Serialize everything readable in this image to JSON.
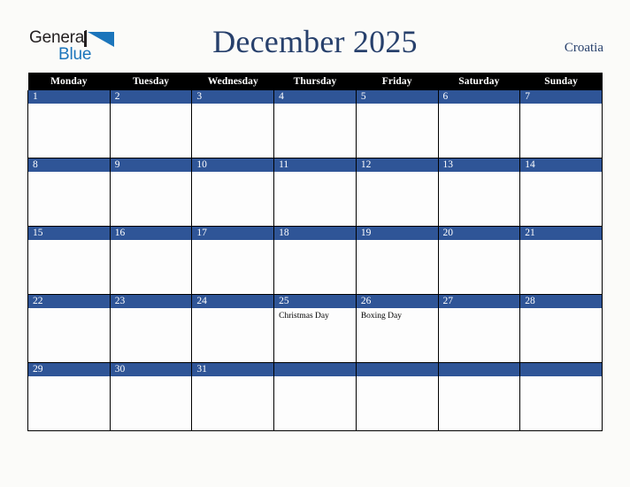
{
  "brand": {
    "word_one": "General",
    "word_two": "Blue",
    "triangle_icon": "triangle-icon",
    "accent_color": "#1b75bb"
  },
  "header": {
    "title": "December 2025",
    "country": "Croatia",
    "title_color": "#27406c"
  },
  "calendar": {
    "weekday_headers": [
      "Monday",
      "Tuesday",
      "Wednesday",
      "Thursday",
      "Friday",
      "Saturday",
      "Sunday"
    ],
    "day_bar_color": "#2f5597",
    "header_bar_color": "#000000",
    "weeks": [
      [
        {
          "day": "1",
          "events": []
        },
        {
          "day": "2",
          "events": []
        },
        {
          "day": "3",
          "events": []
        },
        {
          "day": "4",
          "events": []
        },
        {
          "day": "5",
          "events": []
        },
        {
          "day": "6",
          "events": []
        },
        {
          "day": "7",
          "events": []
        }
      ],
      [
        {
          "day": "8",
          "events": []
        },
        {
          "day": "9",
          "events": []
        },
        {
          "day": "10",
          "events": []
        },
        {
          "day": "11",
          "events": []
        },
        {
          "day": "12",
          "events": []
        },
        {
          "day": "13",
          "events": []
        },
        {
          "day": "14",
          "events": []
        }
      ],
      [
        {
          "day": "15",
          "events": []
        },
        {
          "day": "16",
          "events": []
        },
        {
          "day": "17",
          "events": []
        },
        {
          "day": "18",
          "events": []
        },
        {
          "day": "19",
          "events": []
        },
        {
          "day": "20",
          "events": []
        },
        {
          "day": "21",
          "events": []
        }
      ],
      [
        {
          "day": "22",
          "events": []
        },
        {
          "day": "23",
          "events": []
        },
        {
          "day": "24",
          "events": []
        },
        {
          "day": "25",
          "events": [
            "Christmas Day"
          ]
        },
        {
          "day": "26",
          "events": [
            "Boxing Day"
          ]
        },
        {
          "day": "27",
          "events": []
        },
        {
          "day": "28",
          "events": []
        }
      ],
      [
        {
          "day": "29",
          "events": []
        },
        {
          "day": "30",
          "events": []
        },
        {
          "day": "31",
          "events": []
        },
        {
          "day": "",
          "events": []
        },
        {
          "day": "",
          "events": []
        },
        {
          "day": "",
          "events": []
        },
        {
          "day": "",
          "events": []
        }
      ]
    ]
  }
}
